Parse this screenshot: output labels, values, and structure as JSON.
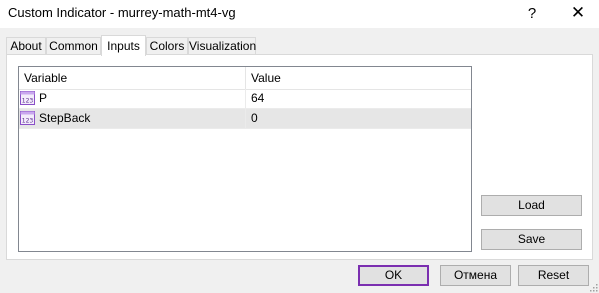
{
  "window": {
    "title": "Custom Indicator - murrey-math-mt4-vg",
    "help_glyph": "?",
    "close_glyph": "✕"
  },
  "tabs": [
    {
      "label": "About",
      "active": false
    },
    {
      "label": "Common",
      "active": false
    },
    {
      "label": "Inputs",
      "active": true
    },
    {
      "label": "Colors",
      "active": false
    },
    {
      "label": "Visualization",
      "active": false
    }
  ],
  "grid": {
    "columns": [
      "Variable",
      "Value"
    ],
    "rows": [
      {
        "icon": "integer-param-icon",
        "name": "P",
        "value": "64",
        "selected": false
      },
      {
        "icon": "integer-param-icon",
        "name": "StepBack",
        "value": "0",
        "selected": true
      }
    ]
  },
  "side_buttons": {
    "load": "Load",
    "save": "Save"
  },
  "footer": {
    "ok": "OK",
    "cancel": "Отмена",
    "reset": "Reset"
  },
  "colors": {
    "accent_default_button": "#7b2fb0",
    "icon_purple": "#8a4fc8"
  }
}
